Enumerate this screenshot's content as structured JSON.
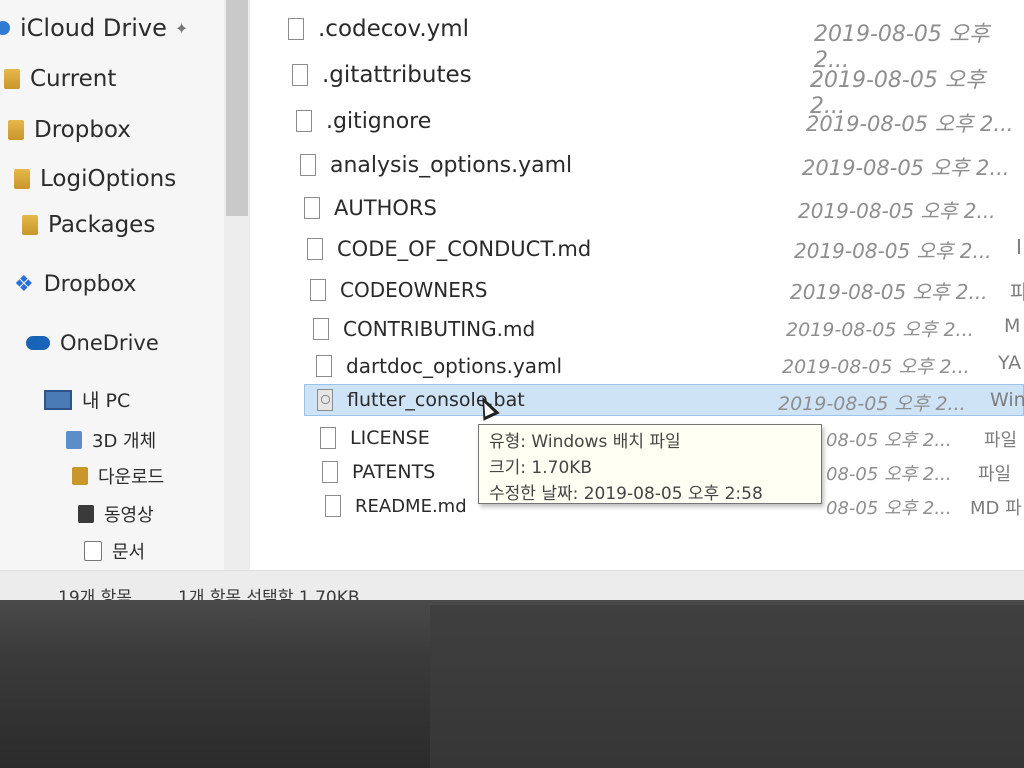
{
  "nav": {
    "items": [
      {
        "label": "iCloud Drive",
        "icon": "icloud-icon"
      },
      {
        "label": "Current",
        "icon": "folder-icon"
      },
      {
        "label": "Dropbox",
        "icon": "folder-icon"
      },
      {
        "label": "LogiOptions",
        "icon": "folder-icon"
      },
      {
        "label": "Packages",
        "icon": "folder-icon"
      },
      {
        "label": "Dropbox",
        "icon": "dropbox-icon"
      },
      {
        "label": "OneDrive",
        "icon": "cloud-icon"
      },
      {
        "label": "내 PC",
        "icon": "pc-icon"
      },
      {
        "label": "3D 개체",
        "icon": "3d-objects-icon"
      },
      {
        "label": "다운로드",
        "icon": "downloads-icon"
      },
      {
        "label": "동영상",
        "icon": "videos-icon"
      },
      {
        "label": "문서",
        "icon": "documents-icon"
      }
    ]
  },
  "files": [
    {
      "name": ".codecov.yml",
      "date": "2019-08-05 오후 2...",
      "type": ""
    },
    {
      "name": ".gitattributes",
      "date": "2019-08-05 오후 2...",
      "type": ""
    },
    {
      "name": ".gitignore",
      "date": "2019-08-05 오후 2...",
      "type": ""
    },
    {
      "name": "analysis_options.yaml",
      "date": "2019-08-05 오후 2...",
      "type": ""
    },
    {
      "name": "AUTHORS",
      "date": "2019-08-05 오후 2...",
      "type": ""
    },
    {
      "name": "CODE_OF_CONDUCT.md",
      "date": "2019-08-05 오후 2...",
      "type": "I"
    },
    {
      "name": "CODEOWNERS",
      "date": "2019-08-05 오후 2...",
      "type": "파"
    },
    {
      "name": "CONTRIBUTING.md",
      "date": "2019-08-05 오후 2...",
      "type": "M"
    },
    {
      "name": "dartdoc_options.yaml",
      "date": "2019-08-05 오후 2...",
      "type": "YA"
    },
    {
      "name": "flutter_console.bat",
      "date": "2019-08-05 오후 2...",
      "type": "Win"
    },
    {
      "name": "LICENSE",
      "date": "08-05 오후 2...",
      "type": "파일"
    },
    {
      "name": "PATENTS",
      "date": "08-05 오후 2...",
      "type": "파일"
    },
    {
      "name": "README.md",
      "date": "08-05 오후 2...",
      "type": "MD 파"
    }
  ],
  "tooltip": {
    "line1": "유형: Windows 배치 파일",
    "line2": "크기: 1.70KB",
    "line3": "수정한 날짜: 2019-08-05 오후 2:58"
  },
  "status": {
    "count": "19개 항목",
    "selection": "1개 항목 선택함 1.70KB"
  }
}
